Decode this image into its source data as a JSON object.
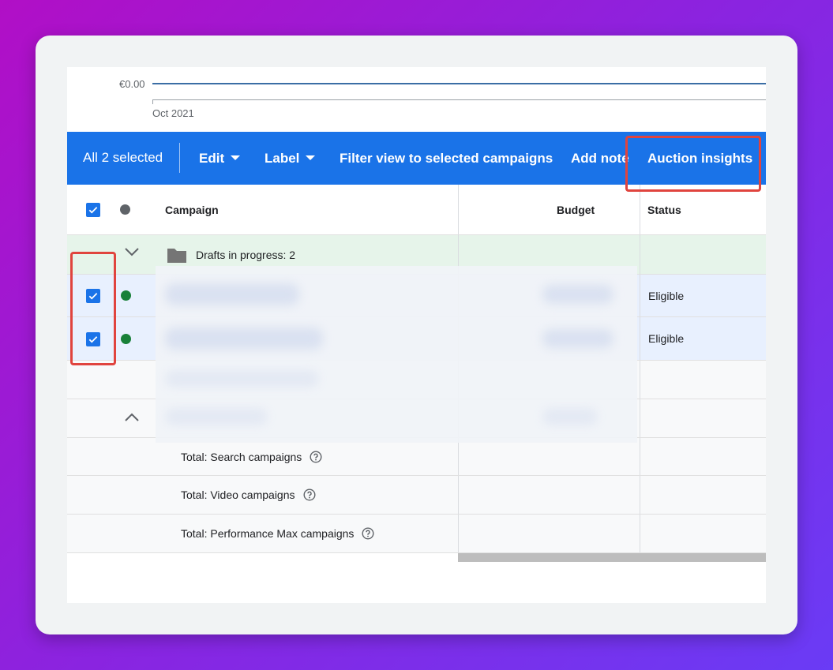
{
  "chart": {
    "y_label": "€0.00",
    "x_label": "Oct 2021",
    "series_color": "#3b6ea5"
  },
  "actionbar": {
    "selected_count": "All 2 selected",
    "edit_label": "Edit",
    "label_label": "Label",
    "filter_label": "Filter view to selected campaigns",
    "add_note_label": "Add note",
    "auction_insights_label": "Auction insights",
    "color": "#1a73e8"
  },
  "table": {
    "headers": {
      "campaign": "Campaign",
      "budget": "Budget",
      "status": "Status"
    },
    "drafts_row": {
      "label": "Drafts in progress: 2",
      "icon": "folder-icon"
    },
    "campaign_rows": [
      {
        "status": "Eligible",
        "selected": true,
        "status_color": "#188038"
      },
      {
        "status": "Eligible",
        "selected": true,
        "status_color": "#188038"
      }
    ],
    "totals": [
      {
        "label": "Total: Search campaigns"
      },
      {
        "label": "Total: Video campaigns"
      },
      {
        "label": "Total: Performance Max campaigns"
      }
    ]
  },
  "highlight_color": "#e0443e"
}
